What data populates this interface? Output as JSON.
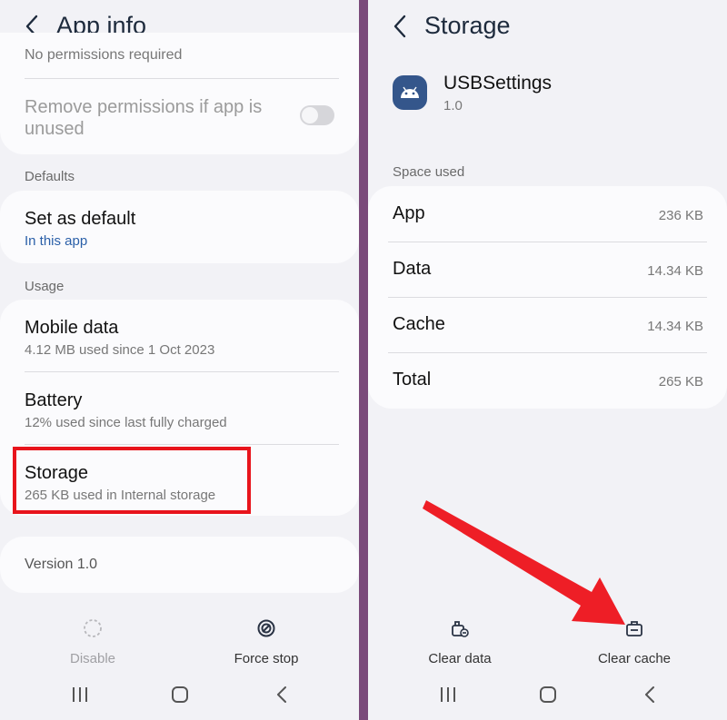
{
  "left": {
    "title": "App info",
    "partial_text": "No permissions required",
    "remove_permissions": {
      "label": "Remove permissions if app is unused",
      "enabled": false
    },
    "defaults_section": "Defaults",
    "set_default": {
      "title": "Set as default",
      "sub": "In this app"
    },
    "usage_section": "Usage",
    "mobile_data": {
      "title": "Mobile data",
      "sub": "4.12 MB used since 1 Oct 2023"
    },
    "battery": {
      "title": "Battery",
      "sub": "12% used since last fully charged"
    },
    "storage": {
      "title": "Storage",
      "sub": "265 KB used in Internal storage"
    },
    "version": "Version 1.0",
    "disable_label": "Disable",
    "force_stop_label": "Force stop",
    "highlight_color": "#e8141c"
  },
  "right": {
    "title": "Storage",
    "app_name": "USBSettings",
    "app_version": "1.0",
    "space_section": "Space used",
    "rows": [
      {
        "label": "App",
        "value": "236 KB"
      },
      {
        "label": "Data",
        "value": "14.34 KB"
      },
      {
        "label": "Cache",
        "value": "14.34 KB"
      },
      {
        "label": "Total",
        "value": "265 KB"
      }
    ],
    "clear_data_label": "Clear data",
    "clear_cache_label": "Clear cache",
    "arrow_color": "#ee1e26"
  },
  "icons": [
    "back-arrow-icon",
    "android-app-icon",
    "disable-icon",
    "force-stop-icon",
    "clear-data-icon",
    "clear-cache-icon",
    "recent-apps-icon",
    "home-icon",
    "nav-back-icon"
  ]
}
